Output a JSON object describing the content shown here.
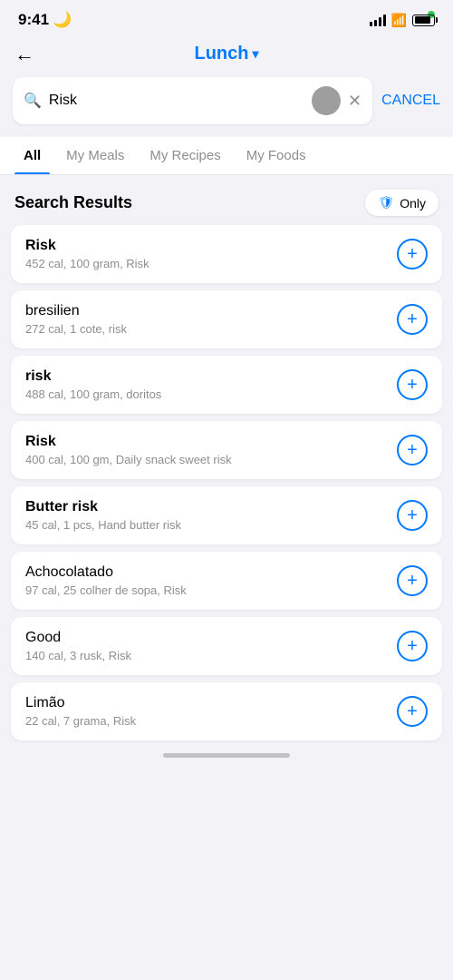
{
  "statusBar": {
    "time": "9:41",
    "moonIcon": "🌙"
  },
  "header": {
    "backLabel": "←",
    "title": "Lunch",
    "chevron": "▾"
  },
  "search": {
    "query": "Risk",
    "cancelLabel": "CANCEL",
    "placeholder": "Search"
  },
  "tabs": [
    {
      "id": "all",
      "label": "All",
      "active": true
    },
    {
      "id": "my-meals",
      "label": "My Meals",
      "active": false
    },
    {
      "id": "my-recipes",
      "label": "My Recipes",
      "active": false
    },
    {
      "id": "my-foods",
      "label": "My Foods",
      "active": false
    }
  ],
  "resultsSection": {
    "title": "Search Results",
    "onlyLabel": "Only"
  },
  "foodItems": [
    {
      "nameBold": "Risk",
      "nameNormal": "",
      "details": "452 cal, 100 gram, Risk"
    },
    {
      "nameBold": "",
      "nameNormal": "bresilien",
      "details": "272 cal, 1 cote, risk"
    },
    {
      "nameBold": "risk",
      "nameNormal": "",
      "details": "488 cal, 100 gram, doritos"
    },
    {
      "nameBold": "Risk",
      "nameNormal": "",
      "details": "400 cal, 100 gm, Daily snack sweet risk"
    },
    {
      "nameBold": "Butter risk",
      "nameNormal": "",
      "details": "45 cal, 1 pcs, Hand butter risk"
    },
    {
      "nameBold": "",
      "nameNormal": "Achocolatado",
      "details": "97 cal, 25 colher de sopa, Risk"
    },
    {
      "nameBold": "",
      "nameNormal": "Good",
      "details": "140 cal, 3 rusk, Risk"
    },
    {
      "nameBold": "",
      "nameNormal": "Limão",
      "details": "22 cal, 7 grama, Risk"
    }
  ]
}
